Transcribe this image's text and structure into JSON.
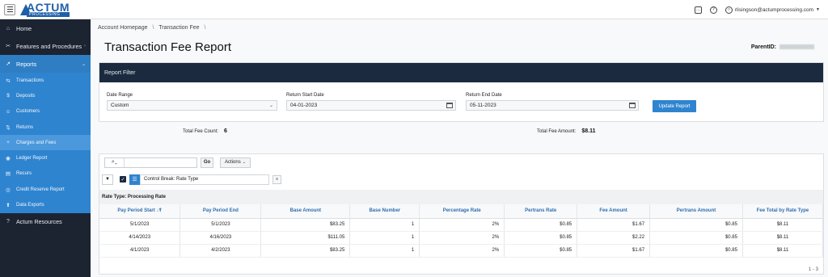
{
  "app": {
    "logo_text": "ACTUM",
    "logo_sub": "PROCESSING"
  },
  "topbar": {
    "user_email": "rlisingson@actumprocessing.com",
    "help_label": "?"
  },
  "sidebar": {
    "items": [
      {
        "label": "Home",
        "icon": "home-icon",
        "glyph": "⌂"
      },
      {
        "label": "Features and Procedures",
        "icon": "tools-icon",
        "glyph": "✂"
      },
      {
        "label": "Reports",
        "icon": "chart-icon",
        "glyph": "↗"
      }
    ],
    "reports_sub": [
      {
        "label": "Transactions",
        "icon": "transactions-icon",
        "glyph": "⇆"
      },
      {
        "label": "Deposits",
        "icon": "dollar-icon",
        "glyph": "$"
      },
      {
        "label": "Customers",
        "icon": "users-icon",
        "glyph": "☺"
      },
      {
        "label": "Returns",
        "icon": "returns-icon",
        "glyph": "⇅"
      },
      {
        "label": "Charges and Fees",
        "icon": "plus-box-icon",
        "glyph": "+"
      },
      {
        "label": "Ledger Report",
        "icon": "ledger-icon",
        "glyph": "◉"
      },
      {
        "label": "Recurs",
        "icon": "recurs-icon",
        "glyph": "▤"
      },
      {
        "label": "Credit Reserve Report",
        "icon": "reserve-icon",
        "glyph": "◎"
      },
      {
        "label": "Data Exports",
        "icon": "export-icon",
        "glyph": "⬆"
      }
    ],
    "resources": {
      "label": "Actum Resources",
      "glyph": "?"
    }
  },
  "breadcrumb": {
    "home": "Account Homepage",
    "current": "Transaction Fee",
    "sep": "\\"
  },
  "page": {
    "title": "Transaction Fee Report",
    "parent_id_label": "ParentID:"
  },
  "filter": {
    "header": "Report Filter",
    "date_range_label": "Date Range",
    "date_range_value": "Custom",
    "start_label": "Return Start Date",
    "start_value": "04-01-2023",
    "end_label": "Return End Date",
    "end_value": "05-11-2023",
    "update_label": "Update Report"
  },
  "summary": {
    "count_label": "Total Fee Count:",
    "count_value": "6",
    "amount_label": "Total Fee Amount:",
    "amount_value": "$8.11"
  },
  "report": {
    "go_label": "Go",
    "actions_label": "Actions",
    "control_break": "Control Break: Rate Type",
    "group_title": "Rate Type: Processing Rate",
    "columns": [
      "Pay Period Start",
      "Pay Period End",
      "Base Amount",
      "Base Number",
      "Percentage Rate",
      "Pertrans Rate",
      "Fee Amount",
      "Pertrans Amount",
      "Fee Total by Rate Type"
    ],
    "rows": [
      [
        "5/1/2023",
        "5/1/2023",
        "$83.25",
        "1",
        "2%",
        "$0.85",
        "$1.67",
        "$0.85",
        "$8.11"
      ],
      [
        "4/14/2023",
        "4/16/2023",
        "$111.05",
        "1",
        "2%",
        "$0.85",
        "$2.22",
        "$0.85",
        "$8.11"
      ],
      [
        "4/1/2023",
        "4/2/2023",
        "$83.25",
        "1",
        "2%",
        "$0.85",
        "$1.67",
        "$0.85",
        "$8.11"
      ]
    ],
    "pager": "1 - 3"
  },
  "colors": {
    "sidebar_bg": "#1c2331",
    "accent": "#2f84cf",
    "filter_header": "#1b2a3f"
  }
}
